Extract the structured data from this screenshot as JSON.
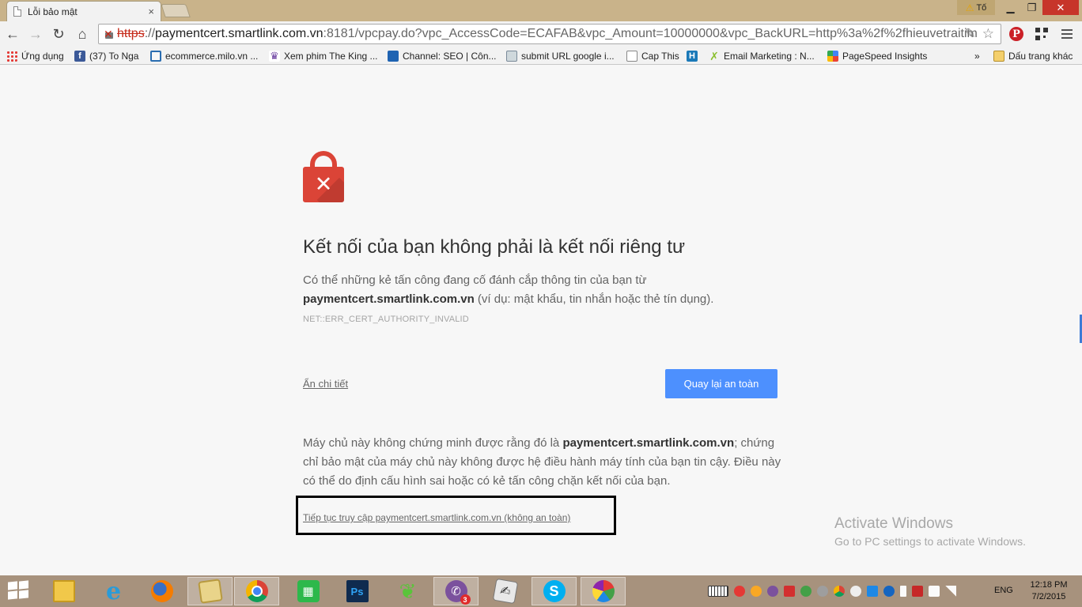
{
  "window": {
    "tab_title": "Lỗi bảo mật",
    "tab_close": "×",
    "profile_label": "Tố",
    "min_icon": "minimize-icon",
    "max_icon": "restore-icon",
    "close_icon": "close-icon"
  },
  "toolbar": {
    "url_scheme": "https",
    "url_sep": "://",
    "url_host": "paymentcert.smartlink.com.vn",
    "url_rest": ":8181/vpcpay.do?vpc_AccessCode=ECAFAB&vpc_Amount=10000000&vpc_BackURL=http%3a%2f%2fhieuvetraitim"
  },
  "bookmarks": [
    {
      "label": "Ứng dụng",
      "icon": "apps-grid-icon"
    },
    {
      "label": "(37) To Nga",
      "icon": "facebook-icon"
    },
    {
      "label": "ecommerce.milo.vn ...",
      "icon": "cart-icon"
    },
    {
      "label": "Xem phim The King ...",
      "icon": "crown-icon"
    },
    {
      "label": "Channel: SEO | Côn...",
      "icon": "gear-icon"
    },
    {
      "label": "submit URL google i...",
      "icon": "submit-icon"
    },
    {
      "label": "Cap This",
      "icon": "page-icon"
    },
    {
      "label": "",
      "icon": "h-icon"
    },
    {
      "label": "Email Marketing : N...",
      "icon": "mail-icon"
    },
    {
      "label": "PageSpeed Insights",
      "icon": "pagespeed-icon"
    }
  ],
  "bookmarks_overflow": "»",
  "other_bookmarks": "Dấu trang khác",
  "interstitial": {
    "title": "Kết nối của bạn không phải là kết nối riêng tư",
    "intro_1": "Có thể những kẻ tấn công đang cố đánh cắp thông tin của bạn từ",
    "intro_host": "paymentcert.smartlink.com.vn",
    "intro_2": " (ví dụ: mật khẩu, tin nhắn hoặc thẻ tín dụng).",
    "error_code": "NET::ERR_CERT_AUTHORITY_INVALID",
    "details_link": "Ẩn chi tiết",
    "back_button": "Quay lại an toàn",
    "detail_1": "Máy chủ này không chứng minh được rằng đó là ",
    "detail_host": "paymentcert.smartlink.com.vn",
    "detail_2": "; chứng chỉ bảo mật của máy chủ này không được hệ điều hành máy tính của bạn tin cậy. Điều này có thể do định cấu hình sai hoặc có kẻ tấn công chặn kết nối của bạn.",
    "proceed_link": "Tiếp tục truy cập paymentcert.smartlink.com.vn (không an toàn)",
    "lock_icon": "broken-lock-icon"
  },
  "watermark": {
    "line1": "Activate Windows",
    "line2": "Go to PC settings to activate Windows."
  },
  "taskbar": {
    "apps": [
      {
        "name": "file-explorer",
        "icon": "folder-icon"
      },
      {
        "name": "internet-explorer",
        "icon": "ie-icon"
      },
      {
        "name": "firefox",
        "icon": "firefox-icon"
      },
      {
        "name": "folders",
        "icon": "folders-icon"
      },
      {
        "name": "chrome",
        "icon": "chrome-icon"
      },
      {
        "name": "store",
        "icon": "store-icon"
      },
      {
        "name": "photoshop",
        "icon": "photoshop-icon",
        "label": "Ps"
      },
      {
        "name": "leaf-app",
        "icon": "leaf-icon"
      },
      {
        "name": "viber",
        "icon": "viber-icon",
        "badge": "3"
      },
      {
        "name": "notes",
        "icon": "notes-icon"
      },
      {
        "name": "skype",
        "icon": "skype-icon",
        "label": "S"
      },
      {
        "name": "paint",
        "icon": "paint-icon"
      }
    ],
    "language": "ENG",
    "time": "12:18 PM",
    "date": "7/2/2015"
  },
  "colors": {
    "title_bar": "#c9b38a",
    "lock_red": "#db4437",
    "button_blue": "#4d90fe",
    "taskbar": "#a7927d"
  }
}
